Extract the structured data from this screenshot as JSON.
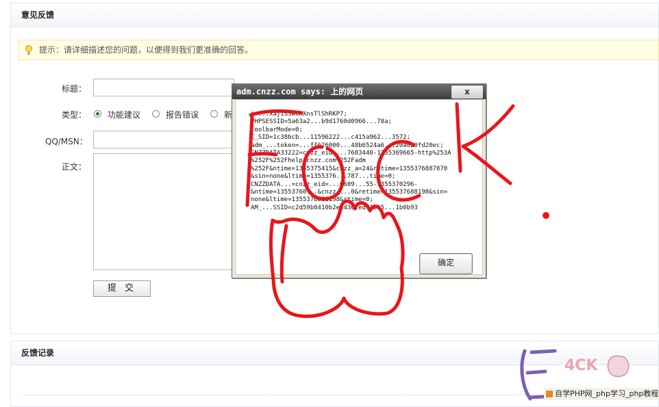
{
  "feedback_panel": {
    "title": "意见反馈"
  },
  "tip": {
    "text": "提示：请详细描述您的问题，以便得到我们更准确的回答。"
  },
  "form": {
    "title_label": "标题：",
    "type_label": "类型：",
    "type_options": [
      {
        "label": "功能建议",
        "selected": true
      },
      {
        "label": "报告错误",
        "selected": false
      },
      {
        "label": "新",
        "selected": false
      }
    ],
    "qq_label": "QQ/MSN：",
    "body_label": "正文：",
    "submit_label": "提 交"
  },
  "records_panel": {
    "title": "反馈记录"
  },
  "dialog": {
    "title": "adm.cnzz.com says: 上的网页",
    "close_label": "x",
    "message_lines": [
      "i=...xajiSSwCAXnsTlShRKP7;",
      "PHPSESSID=5a63a2...b9d1760d0966...78a;",
      "toolbarMode=0;",
      "C_SID=1c38bcb...11596222...c415a962...3572;",
      "adm_...token=...ff626000...48b6524a6...20a020fd20ec;",
      "CNZZDATA33222=cnzz_eid=...7683440-1355369665-http%253A",
      "%252F%252Fhelp.cnzz.com%252Fadm",
      "%252F&ntime=1355375415&cnzz_a=24&retime=1355376887870",
      "&sin=none&ltime=1355376...787...time=0;",
      "CNZZDATA...=cnzz_eid=...6609...55-1355370296-",
      "&ntime=13553760...&cnzz_...0&retime=135537688198&sin=",
      "none&ltime=1355376888198&rtime=0;",
      "AM_...SSID=c2d59b8410b2e3436ced71b65...1b0b93"
    ],
    "ok_label": "确定"
  },
  "overlay": {
    "scribble_color": "#e8161b"
  },
  "watermark": {
    "logo_text": "4CK",
    "caption": "自学PHP网_php学习_php教程"
  }
}
